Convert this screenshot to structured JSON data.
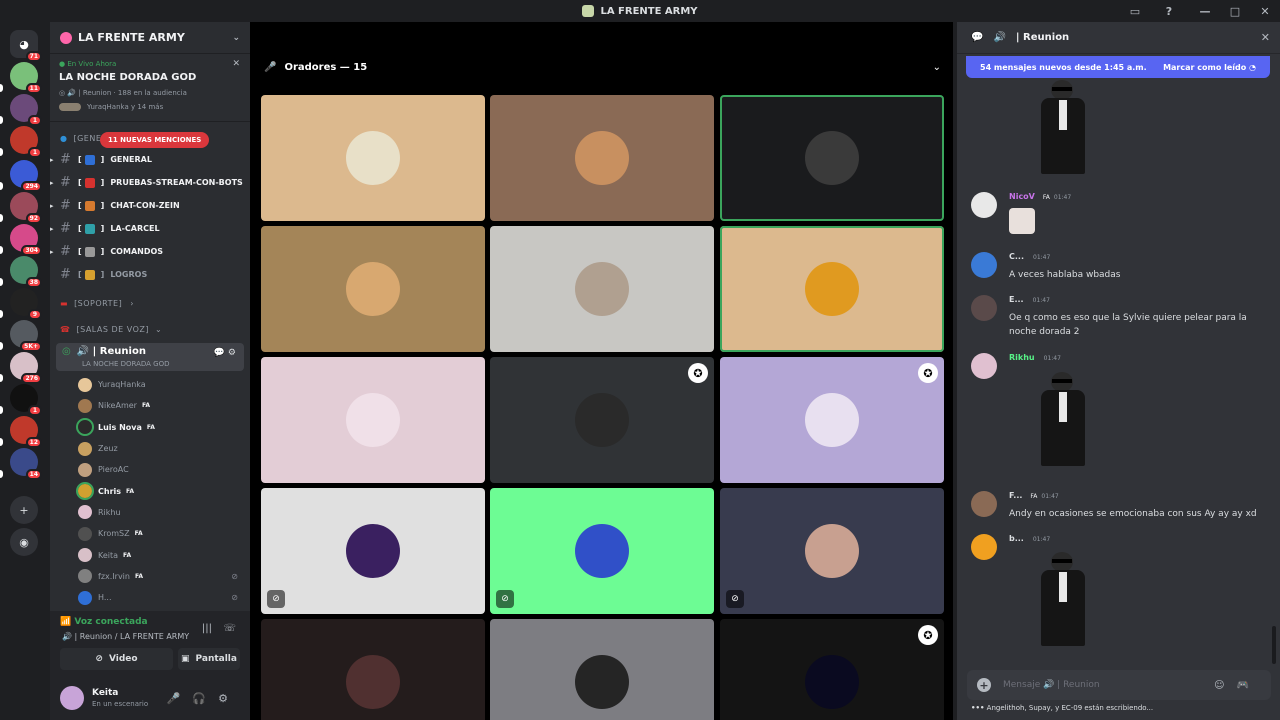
{
  "window": {
    "title": "LA FRENTE ARMY"
  },
  "rail": {
    "servers": [
      {
        "name": "discord-home",
        "badge": "71",
        "color": "#313338"
      },
      {
        "name": "server-1",
        "badge": "11",
        "color": "#7ac07a"
      },
      {
        "name": "server-2",
        "badge": "1",
        "color": "#6b4a7a"
      },
      {
        "name": "server-3",
        "badge": "1",
        "color": "#c0392b"
      },
      {
        "name": "server-4",
        "badge": "294",
        "color": "#3b5bd6"
      },
      {
        "name": "server-5",
        "badge": "92",
        "color": "#9b4a5a"
      },
      {
        "name": "server-6",
        "badge": "304",
        "color": "#d64a8a"
      },
      {
        "name": "server-7",
        "badge": "38",
        "color": "#4a8a6a"
      },
      {
        "name": "server-8",
        "badge": "9",
        "color": "#222222"
      },
      {
        "name": "server-9",
        "badge": "5K+",
        "color": "#555a60"
      },
      {
        "name": "server-10",
        "badge": "276",
        "color": "#d8c0c8"
      },
      {
        "name": "server-11",
        "badge": "1",
        "color": "#111111"
      },
      {
        "name": "server-12",
        "badge": "12",
        "color": "#c0392b"
      },
      {
        "name": "server-13",
        "badge": "14",
        "color": "#3a4a8a"
      }
    ]
  },
  "sidebar": {
    "server_name": "LA FRENTE ARMY",
    "live": {
      "status": "En Vivo Ahora",
      "title": "LA NOCHE DORADA GOD",
      "info": "| Reunion · 188 en la audiencia",
      "people": "YuraqHanka y 14 más",
      "mentions": "11 NUEVAS MENCIONES"
    },
    "cat_general": "[GENERAL]",
    "channels": [
      {
        "label": "GENERAL",
        "color": "#2f6fd6"
      },
      {
        "label": "PRUEBAS-STREAM-CON-BOTS",
        "color": "#d6322f"
      },
      {
        "label": "CHAT-CON-ZEIN",
        "color": "#d67a2f"
      },
      {
        "label": "LA-CARCEL",
        "color": "#2fa0a8"
      },
      {
        "label": "COMANDOS",
        "color": "#999999"
      },
      {
        "label": "LOGROS",
        "color": "#d6a02f"
      }
    ],
    "cat_soporte": "[SOPORTE]",
    "cat_salas": "[SALAS DE VOZ]",
    "voice": {
      "name": "| Reunion",
      "sub": "LA NOCHE DORADA GOD"
    },
    "users": [
      {
        "name": "YuraqHanka",
        "tag": "",
        "color": "#e7c79a",
        "on": false
      },
      {
        "name": "NikeAmer",
        "tag": "FA",
        "color": "#a07850",
        "on": false
      },
      {
        "name": "Luis Nova",
        "tag": "FA",
        "color": "#2a2a2a",
        "on": true
      },
      {
        "name": "Zeuz",
        "tag": "",
        "color": "#c8a060",
        "on": false
      },
      {
        "name": "PieroAC",
        "tag": "",
        "color": "#c0a080",
        "on": false
      },
      {
        "name": "Chris",
        "tag": "FA",
        "color": "#d0a030",
        "on": true
      },
      {
        "name": "Rikhu",
        "tag": "",
        "color": "#e0c0d0",
        "on": false
      },
      {
        "name": "KromSZ",
        "tag": "FA",
        "color": "#505050",
        "on": false
      },
      {
        "name": "Keita",
        "tag": "FA",
        "color": "#d8c0c8",
        "on": false
      },
      {
        "name": "fzx.Irvin",
        "tag": "FA",
        "color": "#808080",
        "on": false
      },
      {
        "name": "H...",
        "tag": "",
        "color": "#2f6fd6",
        "on": false
      }
    ],
    "voice_panel": {
      "status": "Voz conectada",
      "channel": "| Reunion / LA FRENTE ARMY",
      "video": "Video",
      "screen": "Pantalla"
    },
    "me": {
      "name": "Keita",
      "status": "En un escenario"
    }
  },
  "stage": {
    "header": "Oradores — 15",
    "tiles": [
      {
        "bg": "#dcb98e",
        "av": "#e8e0c8",
        "speaking": false,
        "muted": false,
        "mod": false
      },
      {
        "bg": "#8a6a55",
        "av": "#c89060",
        "speaking": false,
        "muted": false,
        "mod": false
      },
      {
        "bg": "#1a1b1d",
        "av": "#3a3a3a",
        "speaking": true,
        "muted": false,
        "mod": false
      },
      {
        "bg": "#a48558",
        "av": "#d8a870",
        "speaking": false,
        "muted": false,
        "mod": false
      },
      {
        "bg": "#c8c7c3",
        "av": "#b0a090",
        "speaking": false,
        "muted": false,
        "mod": false
      },
      {
        "bg": "#dcb98e",
        "av": "#e09a20",
        "speaking": true,
        "muted": false,
        "mod": false
      },
      {
        "bg": "#e3cdd6",
        "av": "#f0e0e8",
        "speaking": false,
        "muted": false,
        "mod": false
      },
      {
        "bg": "#303336",
        "av": "#2a2a2a",
        "speaking": false,
        "muted": false,
        "mod": true
      },
      {
        "bg": "#b4a7d6",
        "av": "#e8e0f0",
        "speaking": false,
        "muted": false,
        "mod": true
      },
      {
        "bg": "#e0e0e0",
        "av": "#3a2060",
        "speaking": false,
        "muted": true,
        "mod": false
      },
      {
        "bg": "#6dfc94",
        "av": "#3050c8",
        "speaking": false,
        "muted": true,
        "mod": false
      },
      {
        "bg": "#383b4e",
        "av": "#c8a090",
        "speaking": false,
        "muted": true,
        "mod": false
      },
      {
        "bg": "#241c1c",
        "av": "#503030",
        "speaking": false,
        "muted": false,
        "mod": false
      },
      {
        "bg": "#7d7d82",
        "av": "#252525",
        "speaking": false,
        "muted": false,
        "mod": false
      },
      {
        "bg": "#141414",
        "av": "#0a0a20",
        "speaking": false,
        "muted": false,
        "mod": true
      }
    ]
  },
  "chat": {
    "channel": "| Reunion",
    "new_messages": "54 mensajes nuevos desde 1:45 a.m.",
    "mark_read": "Marcar como leído",
    "messages": [
      {
        "name": "NicoV",
        "color": "#c774e8",
        "tag": "FA",
        "time": "01:47",
        "text": "",
        "av": "#e8e8e8"
      },
      {
        "name": "C...",
        "color": "#dbdee1",
        "tag": "",
        "time": "01:47",
        "text": "A veces hablaba wbadas",
        "av": "#3a7ad6"
      },
      {
        "name": "E...",
        "color": "#dbdee1",
        "tag": "",
        "time": "01:47",
        "text": "Oe q como es eso que la Sylvie quiere pelear para la noche dorada 2",
        "av": "#5a4a4a"
      },
      {
        "name": "Rikhu",
        "color": "#57f287",
        "tag": "",
        "time": "01:47",
        "text": "",
        "av": "#e0c0d0"
      },
      {
        "name": "F...",
        "color": "#dbdee1",
        "tag": "FA",
        "time": "01:47",
        "text": "Andy en ocasiones se emocionaba con sus Ay ay ay xd",
        "av": "#8a6a55"
      },
      {
        "name": "b...",
        "color": "#dbdee1",
        "tag": "",
        "time": "01:47",
        "text": "",
        "av": "#f0a020"
      }
    ],
    "input_placeholder": "Mensaje 🔊 | Reunion",
    "typing": "Angelithoh, Supay, y EC-09 están escribiendo..."
  }
}
